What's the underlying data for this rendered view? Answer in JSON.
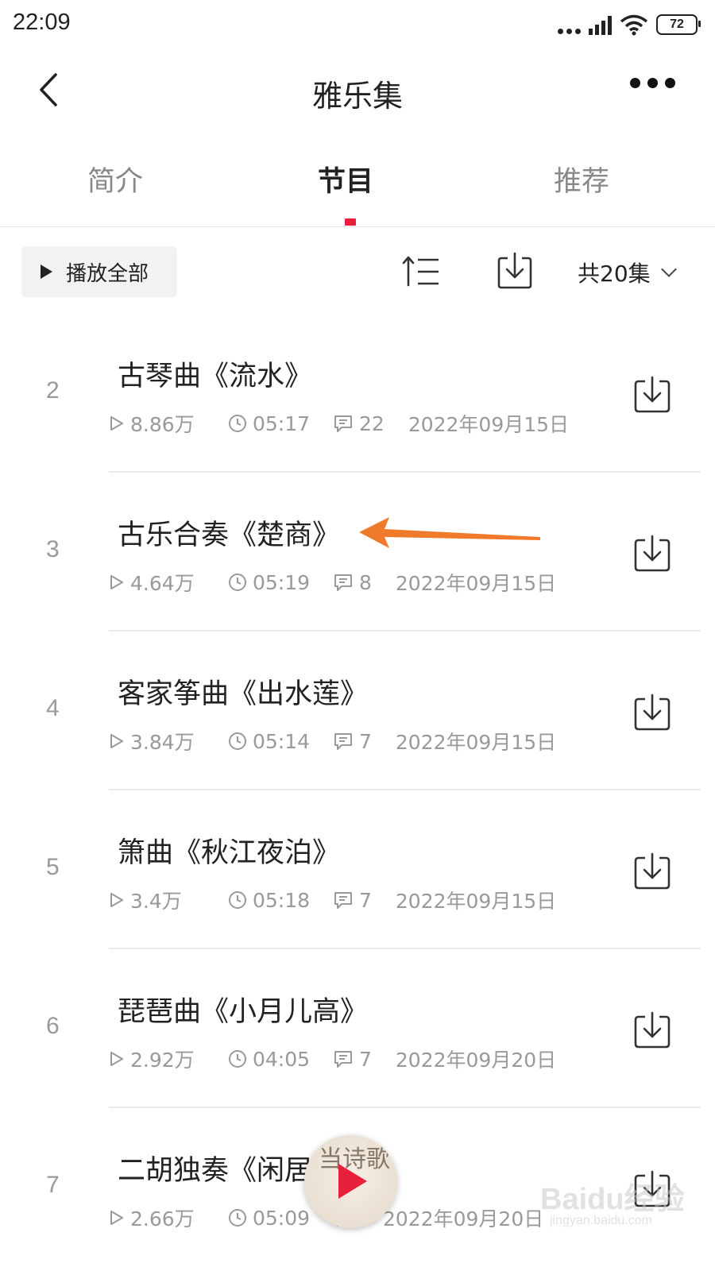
{
  "status_bar": {
    "time": "22:09",
    "battery": "72"
  },
  "header": {
    "title": "雅乐集",
    "back_icon": "chevron-left-icon",
    "more_icon": "more-dots-icon"
  },
  "tabs": [
    {
      "label": "简介",
      "active": false
    },
    {
      "label": "节目",
      "active": true
    },
    {
      "label": "推荐",
      "active": false
    }
  ],
  "toolbar": {
    "play_all_label": "播放全部",
    "count_label": "共20集"
  },
  "episodes": [
    {
      "index": "2",
      "title": "古琴曲《流水》",
      "plays": "8.86万",
      "duration": "05:17",
      "comments": "22",
      "date": "2022年09月15日"
    },
    {
      "index": "3",
      "title": "古乐合奏《楚商》",
      "plays": "4.64万",
      "duration": "05:19",
      "comments": "8",
      "date": "2022年09月15日"
    },
    {
      "index": "4",
      "title": "客家筝曲《出水莲》",
      "plays": "3.84万",
      "duration": "05:14",
      "comments": "7",
      "date": "2022年09月15日"
    },
    {
      "index": "5",
      "title": "箫曲《秋江夜泊》",
      "plays": "3.4万",
      "duration": "05:18",
      "comments": "7",
      "date": "2022年09月15日"
    },
    {
      "index": "6",
      "title": "琵琶曲《小月儿高》",
      "plays": "2.92万",
      "duration": "04:05",
      "comments": "7",
      "date": "2022年09月20日"
    },
    {
      "index": "7",
      "title": "二胡独奏《闲居吟》",
      "plays": "2.66万",
      "duration": "05:09",
      "comments": "",
      "date": "2022年09月20日"
    }
  ],
  "mini_player": {
    "cover_text": "当诗歌"
  },
  "watermark": {
    "main": "Baidu经验",
    "sub": "jingyan.baidu.com"
  },
  "colors": {
    "accent": "#e8203c",
    "annotation_arrow": "#f07a2b"
  }
}
